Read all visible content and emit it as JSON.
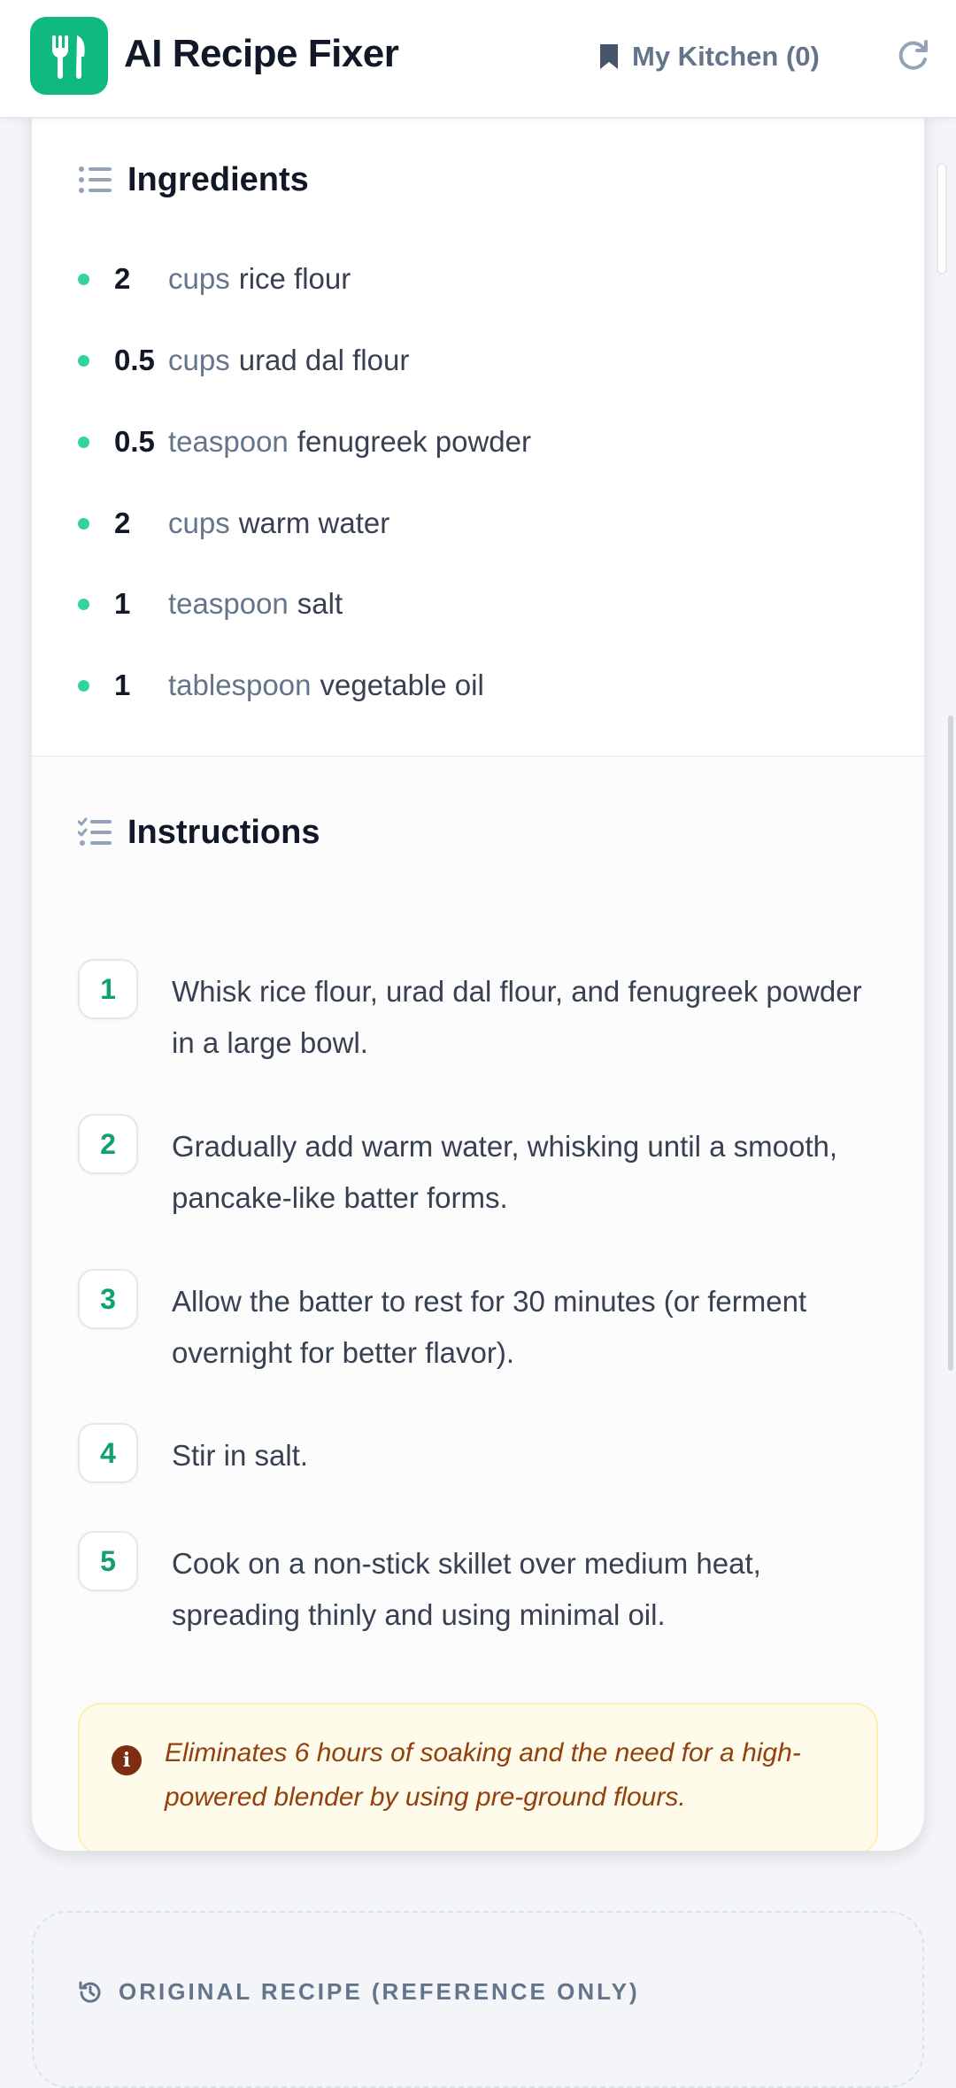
{
  "header": {
    "app_title": "AI Recipe Fixer",
    "logo_icon": "fork-knife-icon",
    "kitchen_label": "My Kitchen (0)",
    "kitchen_icon": "bookmark-icon",
    "refresh_icon": "refresh-icon",
    "accent_color": "#10b981"
  },
  "ingredients": {
    "heading": "Ingredients",
    "icon": "list-icon",
    "items": [
      {
        "qty": "2",
        "unit": "cups",
        "name": "rice flour"
      },
      {
        "qty": "0.5",
        "unit": "cups",
        "name": "urad dal flour"
      },
      {
        "qty": "0.5",
        "unit": "teaspoon",
        "name": "fenugreek powder"
      },
      {
        "qty": "2",
        "unit": "cups",
        "name": "warm water"
      },
      {
        "qty": "1",
        "unit": "teaspoon",
        "name": "salt"
      },
      {
        "qty": "1",
        "unit": "tablespoon",
        "name": "vegetable oil"
      }
    ]
  },
  "instructions": {
    "heading": "Instructions",
    "icon": "checklist-icon",
    "steps": [
      {
        "num": "1",
        "text": "Whisk rice flour, urad dal flour, and fenugreek powder in a large bowl."
      },
      {
        "num": "2",
        "text": "Gradually add warm water, whisking until a smooth, pancake-like batter forms."
      },
      {
        "num": "3",
        "text": "Allow the batter to rest for 30 minutes (or ferment overnight for better flavor)."
      },
      {
        "num": "4",
        "text": "Stir in salt."
      },
      {
        "num": "5",
        "text": "Cook on a non-stick skillet over medium heat, spreading thinly and using minimal oil."
      }
    ]
  },
  "note": {
    "icon": "info-icon",
    "text": "Eliminates 6 hours of soaking and the need for a high-powered blender by using pre-ground flours."
  },
  "original": {
    "icon": "history-icon",
    "heading": "ORIGINAL RECIPE (REFERENCE ONLY)"
  }
}
